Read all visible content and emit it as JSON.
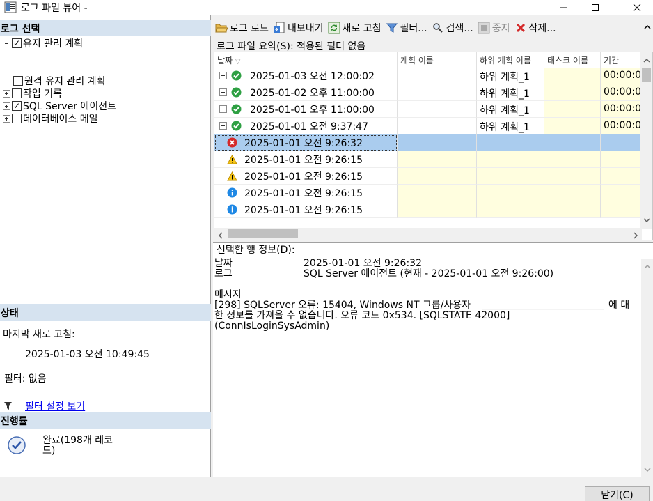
{
  "window": {
    "title": "로그 파일 뷰어 -"
  },
  "left": {
    "log_select_title": "로그 선택",
    "tree": [
      {
        "label": "유지 관리 계획",
        "checked": true,
        "expander": "minus"
      },
      {
        "label": "원격 유지 관리 계획",
        "checked": false,
        "expander": "none"
      },
      {
        "label": "작업 기록",
        "checked": false,
        "expander": "plus"
      },
      {
        "label": "SQL Server 에이전트",
        "checked": true,
        "expander": "plus"
      },
      {
        "label": "데이터베이스 메일",
        "checked": false,
        "expander": "plus"
      }
    ],
    "status_title": "상태",
    "last_refresh_label": "마지막 새로 고침:",
    "last_refresh_value": "2025-01-03 오전 10:49:45",
    "filter_label": "필터: 없음",
    "filter_link": "필터 설정 보기",
    "progress_title": "진행률",
    "progress_text": "완료(198개 레코드)"
  },
  "toolbar": {
    "load_log": "로그 로드",
    "export": "내보내기",
    "refresh": "새로 고침",
    "filter": "필터...",
    "search": "검색...",
    "stop": "중지",
    "delete": "삭제..."
  },
  "summary": "로그 파일 요약(S): 적용된 필터 없음",
  "grid": {
    "columns": [
      "날짜",
      "계획 이름",
      "하위 계획 이름",
      "태스크 이름",
      "기간"
    ],
    "rows": [
      {
        "status": "success",
        "date": "2025-01-03 오전 12:00:02",
        "plan": "",
        "subplan": "하위 계획_1",
        "task": "",
        "duration": "00:00:0",
        "expandable": true
      },
      {
        "status": "success",
        "date": "2025-01-02 오후 11:00:00",
        "plan": "",
        "subplan": "하위 계획_1",
        "task": "",
        "duration": "00:00:0",
        "expandable": true
      },
      {
        "status": "success",
        "date": "2025-01-01 오후 11:00:00",
        "plan": "",
        "subplan": "하위 계획_1",
        "task": "",
        "duration": "00:00:0",
        "expandable": true
      },
      {
        "status": "success",
        "date": "2025-01-01 오전 9:37:47",
        "plan": "",
        "subplan": "하위 계획_1",
        "task": "",
        "duration": "00:00:0",
        "expandable": true
      },
      {
        "status": "error",
        "date": "2025-01-01 오전 9:26:32",
        "plan": "",
        "subplan": "",
        "task": "",
        "duration": "",
        "expandable": false,
        "selected": true
      },
      {
        "status": "warning",
        "date": "2025-01-01 오전 9:26:15",
        "plan": "",
        "subplan": "",
        "task": "",
        "duration": "",
        "expandable": false
      },
      {
        "status": "warning",
        "date": "2025-01-01 오전 9:26:15",
        "plan": "",
        "subplan": "",
        "task": "",
        "duration": "",
        "expandable": false
      },
      {
        "status": "info",
        "date": "2025-01-01 오전 9:26:15",
        "plan": "",
        "subplan": "",
        "task": "",
        "duration": "",
        "expandable": false
      },
      {
        "status": "info",
        "date": "2025-01-01 오전 9:26:15",
        "plan": "",
        "subplan": "",
        "task": "",
        "duration": "",
        "expandable": false
      }
    ]
  },
  "detail": {
    "title": "선택한 행 정보(D):",
    "date_label": "날짜",
    "date_value": "2025-01-01 오전 9:26:32",
    "log_label": "로그",
    "log_value": "SQL Server 에이전트 (현재 - 2025-01-01 오전 9:26:00)",
    "message_label": "메시지",
    "message_line1": "[298] SQLServer 오류: 15404, Windows NT 그룹/사용자",
    "message_line1_end": "에 대",
    "message_line2": "한 정보를 가져올 수 없습니다. 오류 코드 0x534. [SQLSTATE 42000]",
    "message_line3": "(ConnIsLoginSysAdmin)"
  },
  "close_button": "닫기(C)"
}
